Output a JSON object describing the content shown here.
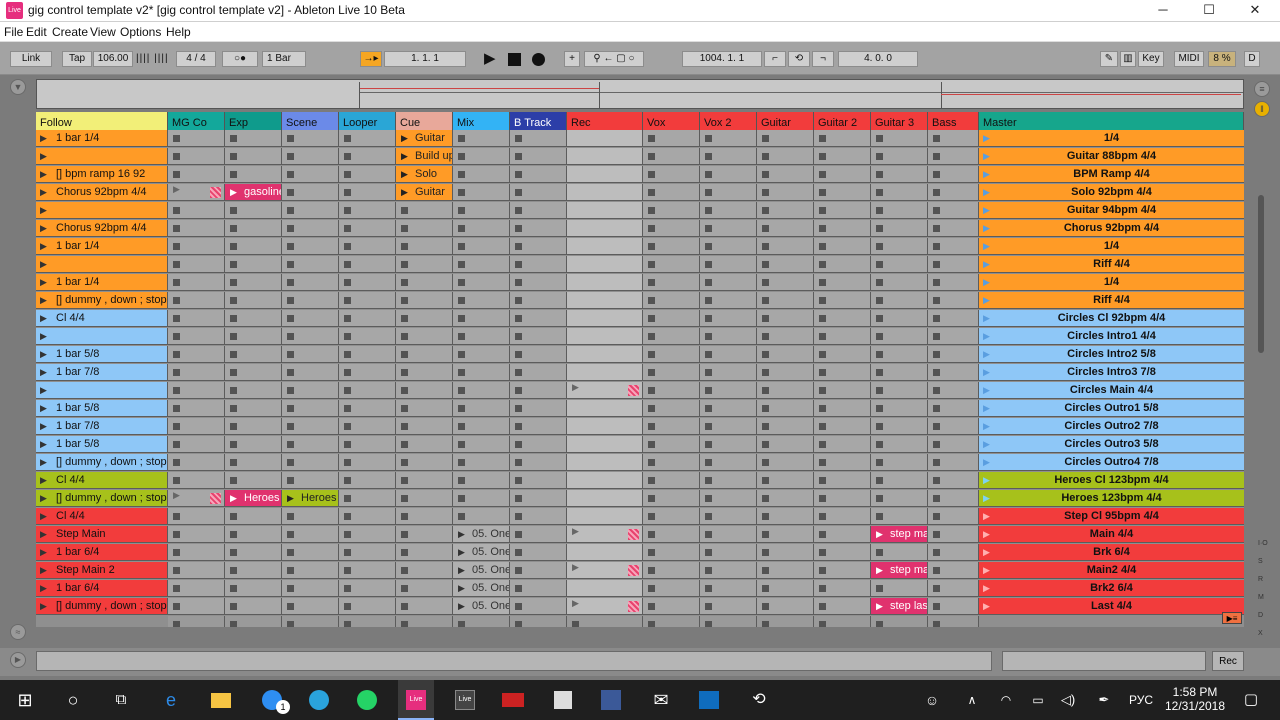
{
  "window": {
    "title": "gig control template v2*  [gig control template v2] - Ableton Live 10 Beta",
    "app_icon": "Live",
    "minimize": "─",
    "maximize": "☐",
    "close": "✕"
  },
  "menu": [
    "File",
    "Edit",
    "Create",
    "View",
    "Options",
    "Help"
  ],
  "transport": {
    "link": "Link",
    "tap": "Tap",
    "tempo": "106.00",
    "signature": "4 / 4",
    "metro": "○●",
    "quantize": "1 Bar",
    "position": "1.   1.   1",
    "loop_start": "1004.   1.   1",
    "loop_length": "4.   0.   0",
    "key": "Key",
    "midi": "MIDI",
    "cpu": "8 %",
    "d": "D"
  },
  "tracks": [
    {
      "name": "MG Co",
      "color": "#13a89b"
    },
    {
      "name": "Exp",
      "color": "#0f9b8c"
    },
    {
      "name": "Scene",
      "color": "#6b8ae8"
    },
    {
      "name": "Looper",
      "color": "#2aa6d6"
    },
    {
      "name": "Cue",
      "color": "#e8a89a"
    },
    {
      "name": "Mix",
      "color": "#33b3f5"
    },
    {
      "name": "B Track",
      "color": "#2c3ea8"
    },
    {
      "name": "Rec",
      "color": "#f23c3c"
    },
    {
      "name": "Vox",
      "color": "#f23c3c"
    },
    {
      "name": "Vox 2",
      "color": "#f23c3c"
    },
    {
      "name": "Guitar",
      "color": "#f23c3c"
    },
    {
      "name": "Guitar 2",
      "color": "#f23c3c"
    },
    {
      "name": "Guitar 3",
      "color": "#f23c3c"
    },
    {
      "name": "Bass",
      "color": "#f23c3c"
    }
  ],
  "follow_header": "Follow",
  "master_header": "Master",
  "scenes": [
    {
      "label": "1 bar 1/4",
      "master": "1/4",
      "color": "orange"
    },
    {
      "label": "",
      "master": "Guitar 88bpm 4/4",
      "color": "orange"
    },
    {
      "label": "[] bpm ramp 16 92",
      "master": "BPM Ramp 4/4",
      "color": "orange"
    },
    {
      "label": "Chorus 92bpm 4/4",
      "master": "Solo 92bpm 4/4",
      "color": "orange"
    },
    {
      "label": "",
      "master": "Guitar 94bpm 4/4",
      "color": "orange"
    },
    {
      "label": "Chorus 92bpm 4/4",
      "master": "Chorus 92bpm 4/4",
      "color": "orange"
    },
    {
      "label": "1 bar 1/4",
      "master": "1/4",
      "color": "orange"
    },
    {
      "label": "",
      "master": "Riff 4/4",
      "color": "orange"
    },
    {
      "label": "1 bar 1/4",
      "master": "1/4",
      "color": "orange"
    },
    {
      "label": "[] dummy , down ; stop",
      "master": "Riff 4/4",
      "color": "orange"
    },
    {
      "label": "Cl 4/4",
      "master": "Circles Cl 92bpm 4/4",
      "color": "blue"
    },
    {
      "label": "",
      "master": "Circles Intro1 4/4",
      "color": "blue"
    },
    {
      "label": "1 bar 5/8",
      "master": "Circles Intro2 5/8",
      "color": "blue"
    },
    {
      "label": "1 bar 7/8",
      "master": "Circles Intro3 7/8",
      "color": "blue"
    },
    {
      "label": "",
      "master": "Circles Main 4/4",
      "color": "blue"
    },
    {
      "label": "1 bar 5/8",
      "master": "Circles Outro1 5/8",
      "color": "blue"
    },
    {
      "label": "1 bar 7/8",
      "master": "Circles Outro2 7/8",
      "color": "blue"
    },
    {
      "label": "1 bar 5/8",
      "master": "Circles Outro3 5/8",
      "color": "blue"
    },
    {
      "label": "[] dummy , down ; stop",
      "master": "Circles Outro4 7/8",
      "color": "blue"
    },
    {
      "label": "Cl 4/4",
      "master": "Heroes Cl 123bpm 4/4",
      "color": "green"
    },
    {
      "label": "[] dummy , down ; stop",
      "master": "Heroes 123bpm 4/4",
      "color": "green"
    },
    {
      "label": "Cl 4/4",
      "master": "Step Cl 95bpm 4/4",
      "color": "red"
    },
    {
      "label": "Step Main",
      "master": "Main 4/4",
      "color": "red"
    },
    {
      "label": "1 bar 6/4",
      "master": "Brk 6/4",
      "color": "red"
    },
    {
      "label": "Step Main 2",
      "master": "Main2 4/4",
      "color": "red"
    },
    {
      "label": "1 bar 6/4",
      "master": "Brk2 6/4",
      "color": "red"
    },
    {
      "label": "[] dummy , down ; stop",
      "master": "Last 4/4",
      "color": "red"
    }
  ],
  "clips": {
    "cue": [
      "Guitar",
      "Build up",
      "Solo",
      "Guitar"
    ],
    "exp_gasoline": "gasoline",
    "exp_heroes": "Heroes",
    "scene_heroes": "Heroes",
    "mix": "05. One",
    "guitar3_a": "step main",
    "guitar3_b": "step main",
    "guitar3_c": "step last"
  },
  "bottom": {
    "rec": "Rec"
  },
  "taskbar": {
    "lang": "РУС",
    "time": "1:58 PM",
    "date": "12/31/2018",
    "live_label": "Live",
    "badge": "1"
  }
}
